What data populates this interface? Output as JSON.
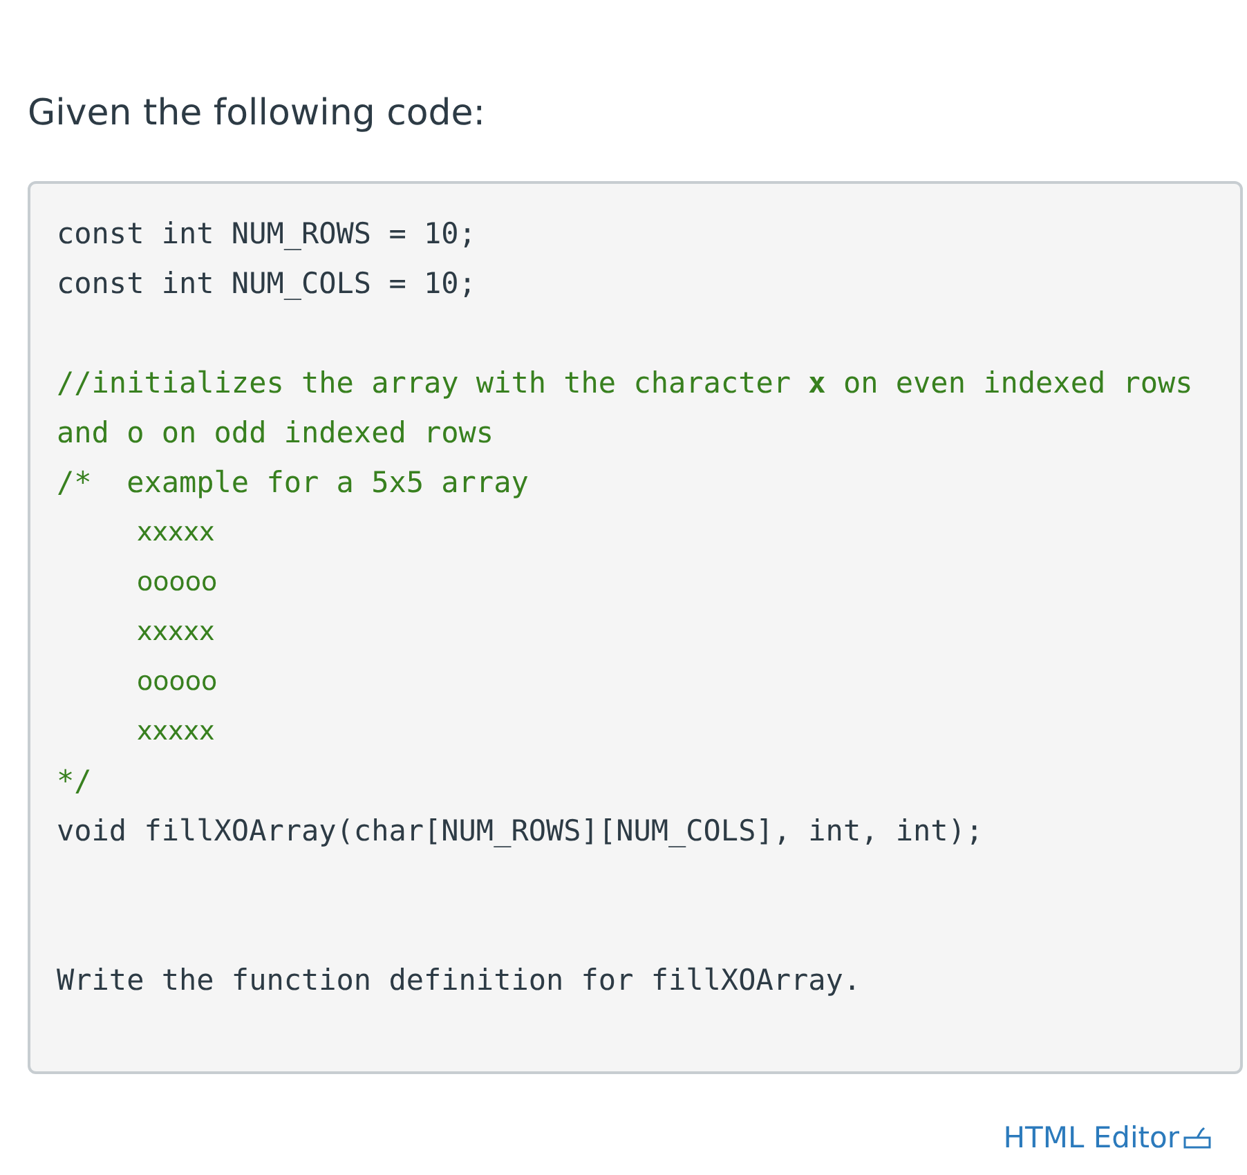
{
  "prompt": "Given the following code:",
  "code_lines": [
    {
      "kind": "code",
      "text": "const int NUM_ROWS = 10;"
    },
    {
      "kind": "code",
      "text": "const int NUM_COLS = 10;"
    },
    {
      "kind": "blank"
    },
    {
      "kind": "comment",
      "text": "//initializes the array with the character **x** on even indexed rows and o on odd indexed rows"
    },
    {
      "kind": "comment",
      "text": "/*  example for a 5x5 array"
    },
    {
      "kind": "art",
      "text": "xxxxx"
    },
    {
      "kind": "art",
      "text": "ooooo"
    },
    {
      "kind": "art",
      "text": "xxxxx"
    },
    {
      "kind": "art",
      "text": "ooooo"
    },
    {
      "kind": "art",
      "text": "xxxxx"
    },
    {
      "kind": "comment",
      "text": "*/"
    },
    {
      "kind": "code",
      "text": "void fillXOArray(char[NUM_ROWS][NUM_COLS], int, int);"
    },
    {
      "kind": "blank"
    },
    {
      "kind": "blank"
    },
    {
      "kind": "code",
      "text": "Write the function definition for fillXOArray."
    }
  ],
  "editor_link": "HTML Editor"
}
